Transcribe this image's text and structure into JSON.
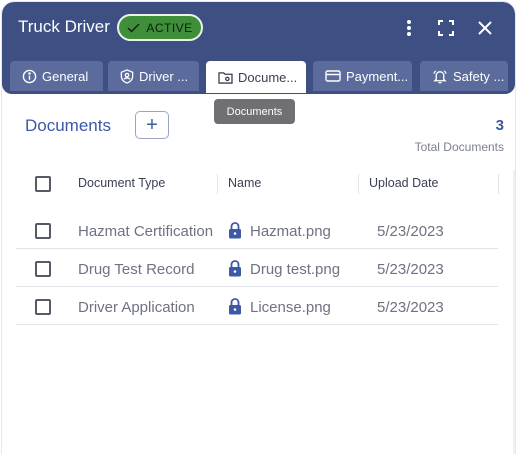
{
  "window": {
    "title": "Truck Driver",
    "status_badge": "ACTIVE",
    "menu_icon": "more-vertical-icon",
    "expand_icon": "fullscreen-icon",
    "close_icon": "close-icon"
  },
  "tabs": [
    {
      "label": "General",
      "icon": "info-circle-icon"
    },
    {
      "label": "Driver ...",
      "icon": "shield-user-icon"
    },
    {
      "label": "Docume...",
      "icon": "folder-icon",
      "active": true
    },
    {
      "label": "Payment...",
      "icon": "credit-card-icon"
    },
    {
      "label": "Safety ...",
      "icon": "bell-alert-icon"
    }
  ],
  "tooltip": "Documents",
  "documents": {
    "title": "Documents",
    "add_label": "+",
    "count": "3",
    "count_label": "Total Documents",
    "columns": [
      "Document Type",
      "Name",
      "Upload Date"
    ],
    "rows": [
      {
        "type": "Hazmat Certification",
        "name": "Hazmat.png",
        "date": "5/23/2023"
      },
      {
        "type": "Drug Test Record",
        "name": "Drug test.png",
        "date": "5/23/2023"
      },
      {
        "type": "Driver Application",
        "name": "License.png",
        "date": "5/23/2023"
      }
    ]
  },
  "colors": {
    "header": "#3d4f83",
    "tab": "#5b6c9c",
    "accent": "#3e58a8",
    "active_badge": "#3e8e3a"
  }
}
